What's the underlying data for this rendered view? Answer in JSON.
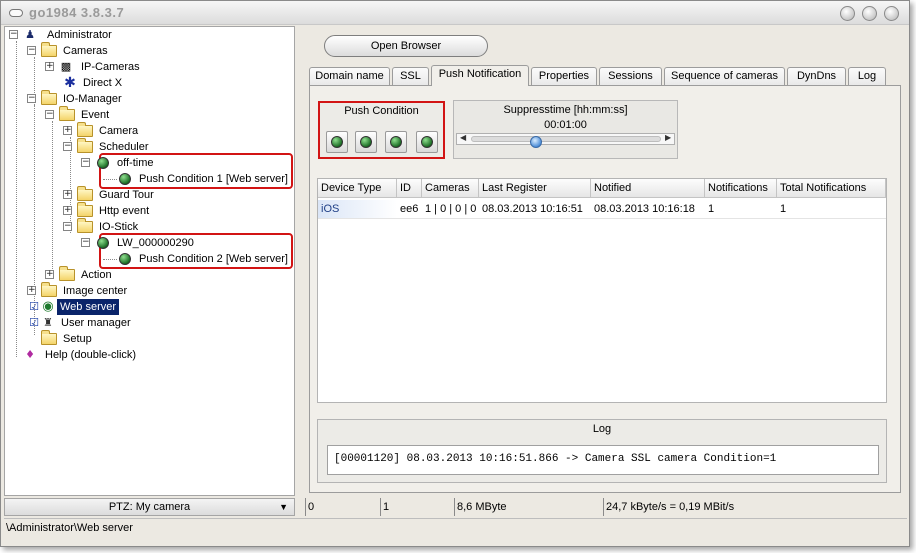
{
  "window": {
    "title": "go1984 3.8.3.7"
  },
  "tree": {
    "administrator": "Administrator",
    "cameras": "Cameras",
    "ip_cameras": "IP-Cameras",
    "direct_x": "Direct X",
    "io_manager": "IO-Manager",
    "event": "Event",
    "camera": "Camera",
    "scheduler": "Scheduler",
    "off_time": "off-time",
    "push_condition_1": "Push Condition 1 [Web server]",
    "guard_tour": "Guard Tour",
    "http_event": "Http event",
    "io_stick": "IO-Stick",
    "lw_id": "LW_000000290",
    "push_condition_2": "Push Condition 2 [Web server]",
    "action": "Action",
    "image_center": "Image center",
    "web_server": "Web server",
    "user_manager": "User manager",
    "setup": "Setup",
    "help": "Help (double-click)"
  },
  "ptz": {
    "label": "PTZ: My camera"
  },
  "statusbar": {
    "path": "\\Administrator\\Web server",
    "cells": [
      "0",
      "1",
      "8,6 MByte",
      "24,7 kByte/s = 0,19 MBit/s"
    ]
  },
  "toolbar": {
    "open_browser": "Open Browser"
  },
  "tabs": [
    {
      "label": "Domain name"
    },
    {
      "label": "SSL"
    },
    {
      "label": "Push Notification"
    },
    {
      "label": "Properties"
    },
    {
      "label": "Sessions"
    },
    {
      "label": "Sequence of cameras"
    },
    {
      "label": "DynDns"
    },
    {
      "label": "Log"
    }
  ],
  "push_condition": {
    "title": "Push Condition"
  },
  "suppress": {
    "title": "Suppresstime [hh:mm:ss]",
    "time": "00:01:00"
  },
  "table": {
    "headers": [
      "Device Type",
      "ID",
      "Cameras",
      "Last Register",
      "Notified",
      "Notifications",
      "Total Notifications"
    ],
    "rows": [
      [
        "iOS",
        "ee6",
        "1 | 0 | 0 | 0",
        "08.03.2013 10:16:51",
        "08.03.2013 10:16:18",
        "1",
        "1"
      ]
    ]
  },
  "log": {
    "title": "Log",
    "text": "[00001120] 08.03.2013 10:16:51.866 -> Camera SSL camera Condition=1"
  }
}
